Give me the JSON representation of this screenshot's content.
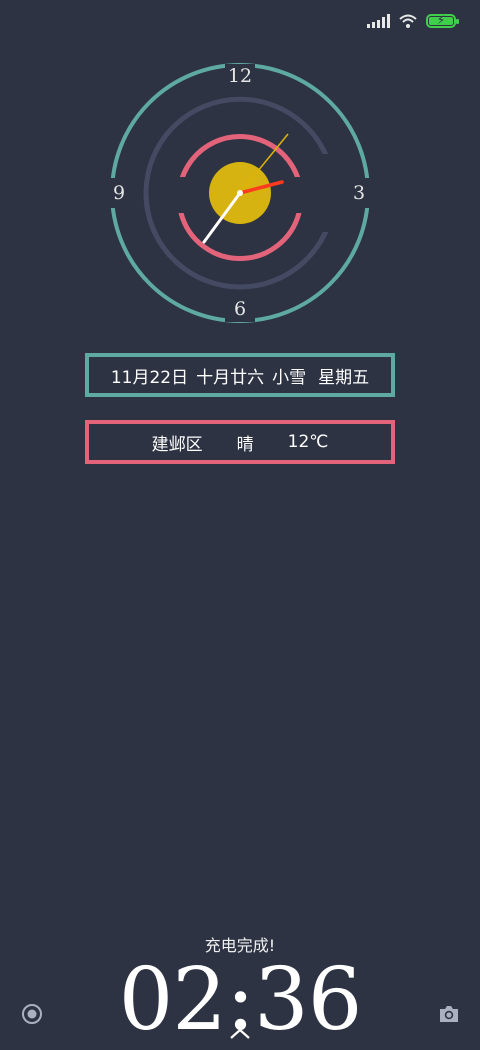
{
  "status_bar": {
    "signal_icon": "signal-icon",
    "wifi_icon": "wifi-icon",
    "battery_icon": "battery-charging-icon",
    "battery_color": "#3fcf4a"
  },
  "clock": {
    "numerals": {
      "top": "12",
      "right": "3",
      "bottom": "6",
      "left": "9"
    },
    "time_shown": {
      "hour": 2,
      "minute": 36,
      "second": 7
    },
    "colors": {
      "outer_ring": "#5eaaa2",
      "middle_ring": "#454a63",
      "inner_ring": "#e3647a",
      "center_disc": "#d6b310",
      "hour_hand": "#ff3b1f",
      "minute_hand": "#ffffff",
      "second_hand": "#e0b400"
    }
  },
  "date_line": {
    "date": "11月22日",
    "lunar": "十月廿六",
    "solar_term": "小雪",
    "weekday": "星期五"
  },
  "weather": {
    "district": "建邺区",
    "condition": "晴",
    "temperature": "12℃"
  },
  "lock_screen": {
    "charging_status": "充电完成!",
    "time": "02:36"
  },
  "icons": {
    "left_shortcut": "record-icon",
    "right_shortcut": "camera-icon",
    "unlock_hint": "chevron-up-icon"
  }
}
